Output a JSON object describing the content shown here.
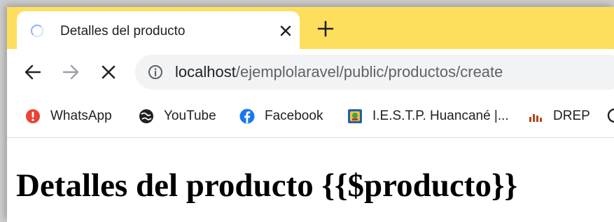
{
  "tab": {
    "title": "Detalles del producto"
  },
  "address_bar": {
    "url_host": "localhost",
    "url_path": "/ejemplolaravel/public/productos/create"
  },
  "bookmarks": [
    {
      "label": "WhatsApp",
      "icon": "whatsapp-icon"
    },
    {
      "label": "YouTube",
      "icon": "youtube-icon"
    },
    {
      "label": "Facebook",
      "icon": "facebook-icon"
    },
    {
      "label": "I.E.S.T.P. Huancané |...",
      "icon": "iestp-huancane-icon"
    },
    {
      "label": "DREP",
      "icon": "drep-icon"
    }
  ],
  "page": {
    "heading": "Detalles del producto {{$producto}}"
  },
  "colors": {
    "tabstrip": "#fedf5d",
    "omnibox": "#f1f3f4",
    "facebook": "#1877f2",
    "whatsapp_badge": "#ea4335"
  }
}
